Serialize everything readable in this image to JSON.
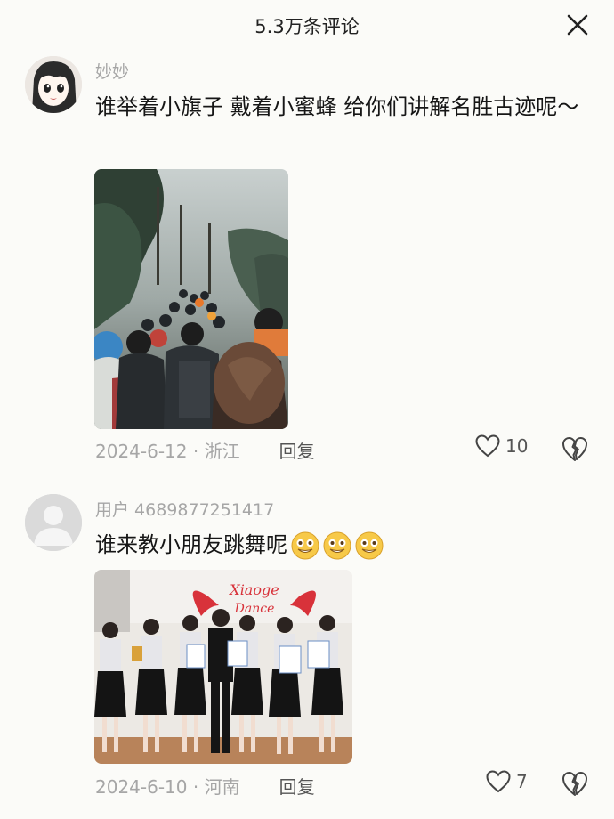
{
  "header": {
    "title": "5.3万条评论"
  },
  "comments": [
    {
      "username": "妙妙",
      "text": "谁举着小旗子 戴着小蜜蜂 给你们讲解名胜古迹呢～",
      "date_location": "2024-6-12 · 浙江",
      "reply_label": "回复",
      "likes": "10",
      "avatar_icon": "anime-girl-avatar",
      "photo_icon": "crowded-mountain-trail-photo"
    },
    {
      "username": "用户 4689877251417",
      "text": "谁来教小朋友跳舞呢",
      "date_location": "2024-6-10 · 河南",
      "reply_label": "回复",
      "likes": "7",
      "avatar_icon": "default-user-avatar",
      "photo_icon": "dance-class-group-photo",
      "photo_sign_text": "Xiaoge Dance"
    }
  ],
  "colors": {
    "background": "#fbfbf8",
    "muted": "#a6a6a6",
    "text": "#161616"
  }
}
